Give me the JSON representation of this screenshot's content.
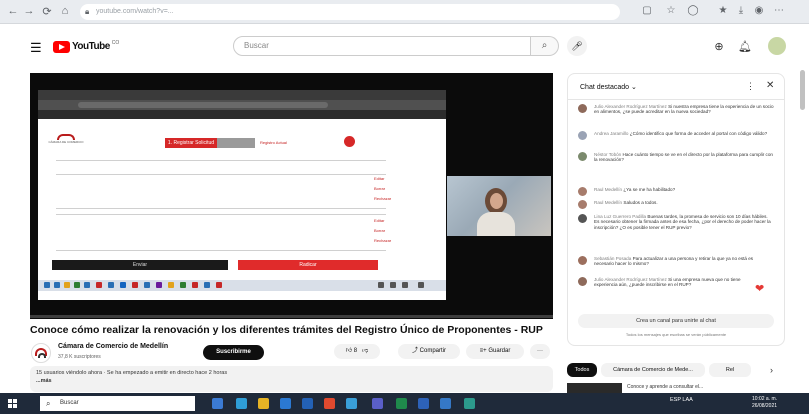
{
  "browser": {
    "url": "youtube.com/watch?v=...",
    "nav_icons": [
      "back-icon",
      "forward-icon",
      "reload-icon",
      "home-icon"
    ]
  },
  "header": {
    "logo_text": "YouTube",
    "logo_country": "CO",
    "search_placeholder": "Buscar"
  },
  "video": {
    "inner_page": {
      "primary_tab": "1. Registrar Solicitud",
      "secondary_tab": "Registro Actual",
      "row_action_1": "Editar",
      "row_action_2": "Borrar",
      "row_action_3": "Rechazar",
      "btn_black": "Enviar",
      "btn_red": "Radicar"
    }
  },
  "title": "Conoce cómo realizar la renovación y los diferentes trámites del Registro Único de Proponentes - RUP",
  "channel": {
    "name": "Cámara de Comercio de Medellín",
    "subscribers": "37,8 K suscriptores",
    "subscribe_label": "Suscribirme"
  },
  "actions": {
    "likes": "8",
    "share_label": "Compartir",
    "save_label": "Guardar",
    "more_label": "···"
  },
  "description": {
    "line1": "15 usuarios viéndolo ahora · Se ha empezado a emitir en directo hace 2 horas",
    "line2": "...más"
  },
  "chat": {
    "title": "Chat destacado",
    "input_label": "Crea un canal para unirte al chat",
    "note": "Todos los mensajes que escribas se verán públicamente",
    "messages": [
      {
        "author": "Julio Alexander Rodríguez Martínez",
        "text": "Si nuestra empresa tiene la experiencia de un socio en alimentos, ¿se puede acreditar en la nueva sociedad?",
        "color": "#8e6a5b"
      },
      {
        "author": "Andrea Jaramillo",
        "text": "¿Cómo identifico que forma de acceder al portal con código válido?",
        "color": "#9aa3b5"
      },
      {
        "author": "Néstor Tobón",
        "text": "Hace cuánto tiempo se ve en el directo por la plataforma para cumplir con la renovación?",
        "color": "#7b8a6d"
      },
      {
        "author": "Raul Medellín",
        "text": "¿Ya se me ha habilitado?",
        "color": "#a77c6c"
      },
      {
        "author": "Raul Medellín",
        "text": "Saludos a todos.",
        "color": "#a77c6c"
      },
      {
        "author": "Lina Luz Guerrero Padilla",
        "text": "Buenas tardes, la promesa de servicio son 10 días hábiles. Es necesario obtener la firmada antes de esa fecha, ¿por el derecho de poder hacer la inscripción? ¿O es posible tener el RUP previo?",
        "color": "#555555"
      },
      {
        "author": "Sebastián Posada",
        "text": "Para actualizar a una persona y retirar la que ya no está es necesario hacer lo mismo?",
        "color": "#9c6f5e"
      },
      {
        "author": "Julio Alexander Rodríguez Martínez",
        "text": "Si una empresa nueva que no tiene experiencia aún, ¿puede inscribirse en el RUP?",
        "color": "#8e6a5b"
      }
    ]
  },
  "related": {
    "chip_all": "Todos",
    "chip_channel": "Cámara de Comercio de Mede...",
    "chip_more": "Rel",
    "video_title": "Conoce y aprende a consultar el..."
  },
  "taskbar": {
    "search_placeholder": "Buscar",
    "time": "10:02 a. m.",
    "date": "26/08/2021",
    "tray_text": "ESP LAA"
  },
  "colors": {
    "youtube_red": "#ff0000",
    "subscribe_black": "#0f0f0f",
    "chat_heart": "#e53935"
  }
}
